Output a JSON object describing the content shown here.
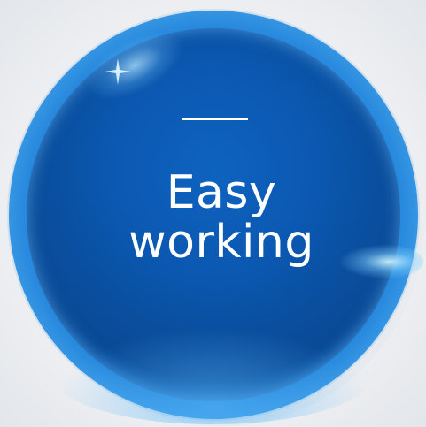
{
  "badge": {
    "line1": "Easy",
    "line2": "working",
    "colors": {
      "core": "#0b58b1",
      "rim": "#5bb6f3",
      "text": "#ffffff",
      "background": "#eceef1"
    }
  }
}
